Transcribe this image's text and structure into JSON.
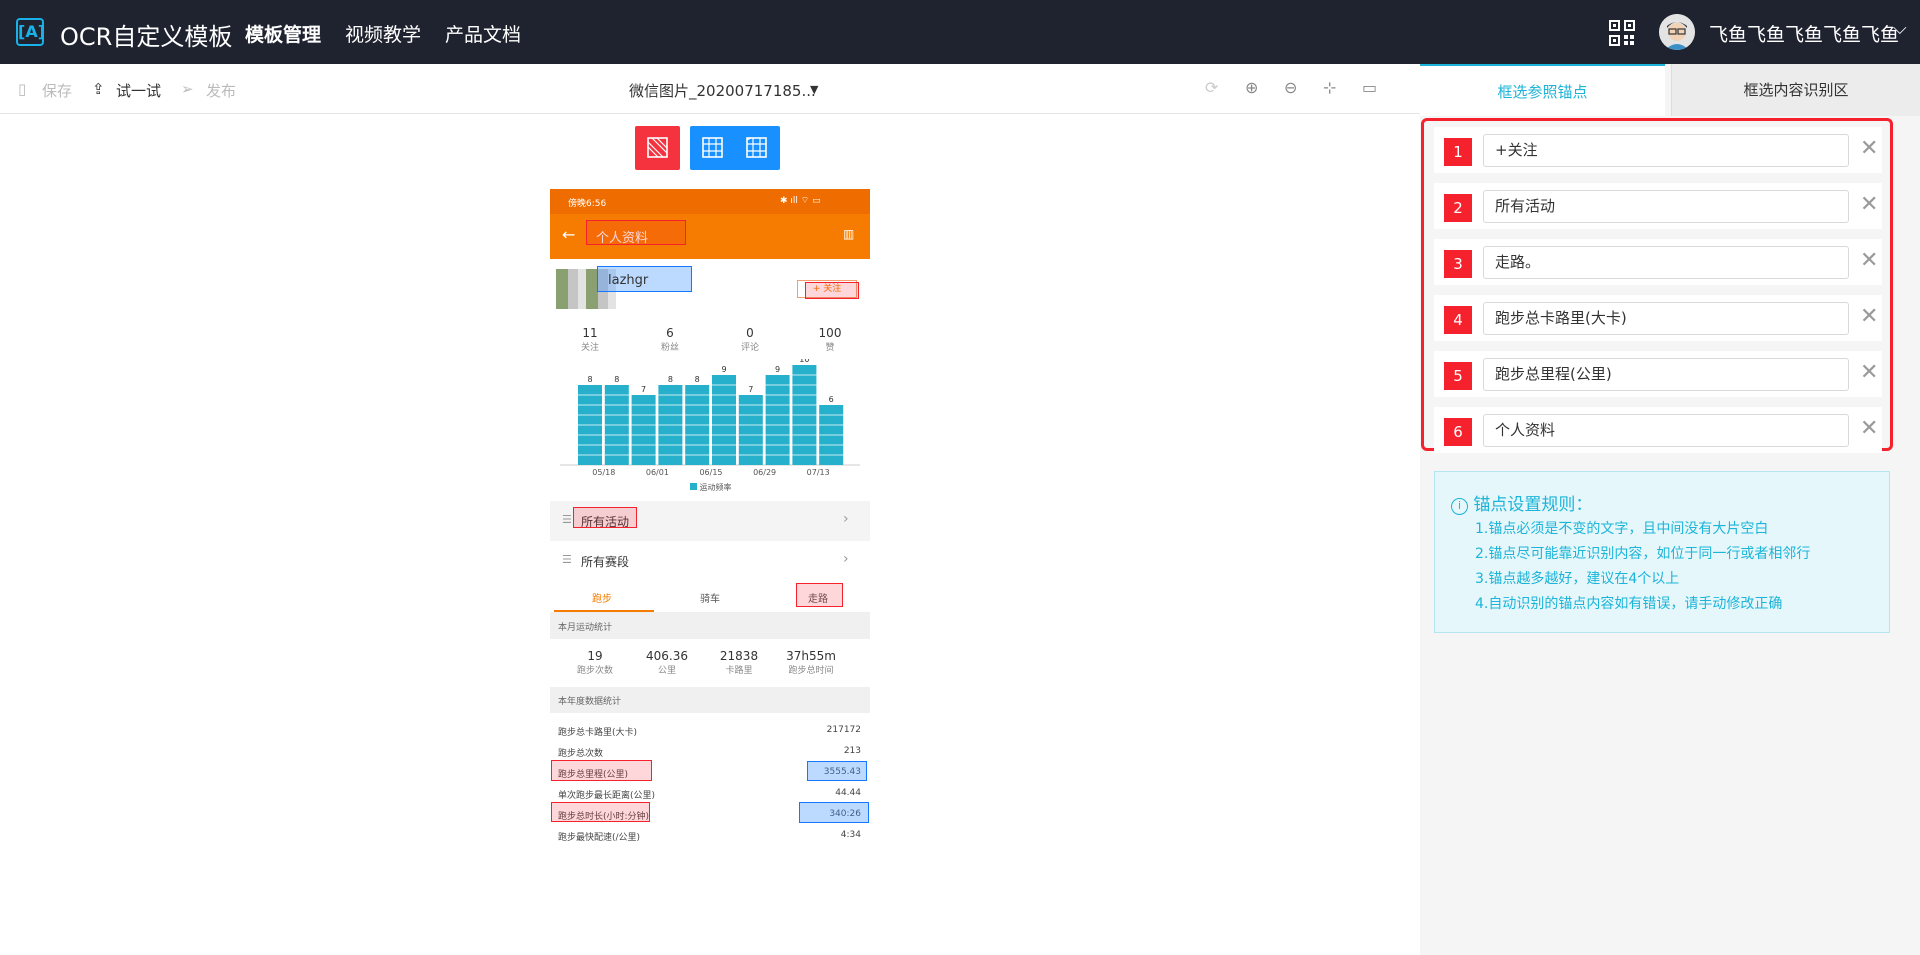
{
  "header": {
    "logo": "[A]",
    "app_name": "OCR自定义模板",
    "nav": [
      "模板管理",
      "视频教学",
      "产品文档"
    ],
    "username": "飞鱼飞鱼飞鱼飞鱼飞鱼"
  },
  "toolbar": {
    "save": "保存",
    "try": "试一试",
    "publish": "发布",
    "filename": "微信图片_20200717185..."
  },
  "tabs": [
    "框选参照锚点",
    "框选内容识别区"
  ],
  "anchors": [
    {
      "num": "1",
      "value": "+关注"
    },
    {
      "num": "2",
      "value": "所有活动"
    },
    {
      "num": "3",
      "value": "走路。"
    },
    {
      "num": "4",
      "value": "跑步总卡路里(大卡)"
    },
    {
      "num": "5",
      "value": "跑步总里程(公里)"
    },
    {
      "num": "6",
      "value": "个人资料"
    }
  ],
  "rules": {
    "title": "锚点设置规则：",
    "items": [
      "1.锚点必须是不变的文字，且中间没有大片空白",
      "2.锚点尽可能靠近识别内容，如位于同一行或者相邻行",
      "3.锚点越多越好，建议在4个以上",
      "4.自动识别的锚点内容如有错误，请手动修改正确"
    ]
  },
  "phone": {
    "status_time": "傍晚6:56",
    "title": "个人资料",
    "username": "lazhgr",
    "follow": "+ 关注",
    "stats": [
      {
        "n": "11",
        "l": "关注"
      },
      {
        "n": "6",
        "l": "粉丝"
      },
      {
        "n": "0",
        "l": "评论"
      },
      {
        "n": "100",
        "l": "赞"
      }
    ],
    "chart_legend": "运动频率",
    "chart_xticks": [
      "05/18",
      "06/01",
      "06/15",
      "06/29",
      "07/13"
    ],
    "all_activities": "所有活动",
    "all_races": "所有赛段",
    "sport_tabs": [
      "跑步",
      "骑车",
      "走路"
    ],
    "month_title": "本月运动统计",
    "month_stats": [
      {
        "n": "19",
        "l": "跑步次数"
      },
      {
        "n": "406.36",
        "l": "公里"
      },
      {
        "n": "21838",
        "l": "卡路里"
      },
      {
        "n": "37h55m",
        "l": "跑步总时间"
      }
    ],
    "year_title": "本年度数据统计",
    "year_rows": [
      {
        "label": "跑步总卡路里(大卡)",
        "value": "217172"
      },
      {
        "label": "跑步总次数",
        "value": "213"
      },
      {
        "label": "跑步总里程(公里)",
        "value": "3555.43"
      },
      {
        "label": "单次跑步最长距离(公里)",
        "value": "44.44"
      },
      {
        "label": "跑步总时长(小时:分钟)",
        "value": "340:26"
      },
      {
        "label": "跑步最快配速(/公里)",
        "value": "4:34"
      }
    ]
  },
  "chart_data": {
    "type": "bar",
    "values": [
      8,
      8,
      7,
      8,
      8,
      9,
      7,
      9,
      10,
      6
    ],
    "xticks": [
      "05/18",
      "06/01",
      "06/15",
      "06/29",
      "07/13"
    ],
    "legend": "运动频率",
    "color": "#26b0cc"
  }
}
